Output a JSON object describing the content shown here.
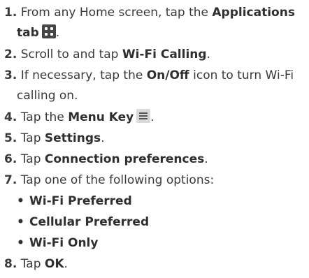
{
  "steps": [
    {
      "num": "1.",
      "pre": "From any Home screen, tap the ",
      "bold": "Applications",
      "line2_bold": "tab",
      "post": "."
    },
    {
      "num": "2.",
      "pre": "Scroll to and tap ",
      "bold": "Wi-Fi Calling",
      "post": "."
    },
    {
      "num": "3.",
      "pre": "If necessary, tap the ",
      "bold": "On/Off",
      "post": " icon to turn Wi-Fi",
      "line2": "calling on."
    },
    {
      "num": "4.",
      "pre": "Tap the ",
      "bold": "Menu Key",
      "post": "."
    },
    {
      "num": "5.",
      "pre": "Tap ",
      "bold": "Settings",
      "post": "."
    },
    {
      "num": "6.",
      "pre": "Tap ",
      "bold": "Connection preferences",
      "post": "."
    },
    {
      "num": "7.",
      "pre": "Tap one of the following options:"
    },
    {
      "num": "8.",
      "pre": "Tap ",
      "bold": "OK",
      "post": "."
    }
  ],
  "options": [
    "Wi-Fi Preferred",
    "Cellular Preferred",
    "Wi-Fi Only"
  ],
  "bullet": "•",
  "icons": {
    "applications": "applications-grid-icon",
    "menu": "menu-key-icon"
  }
}
